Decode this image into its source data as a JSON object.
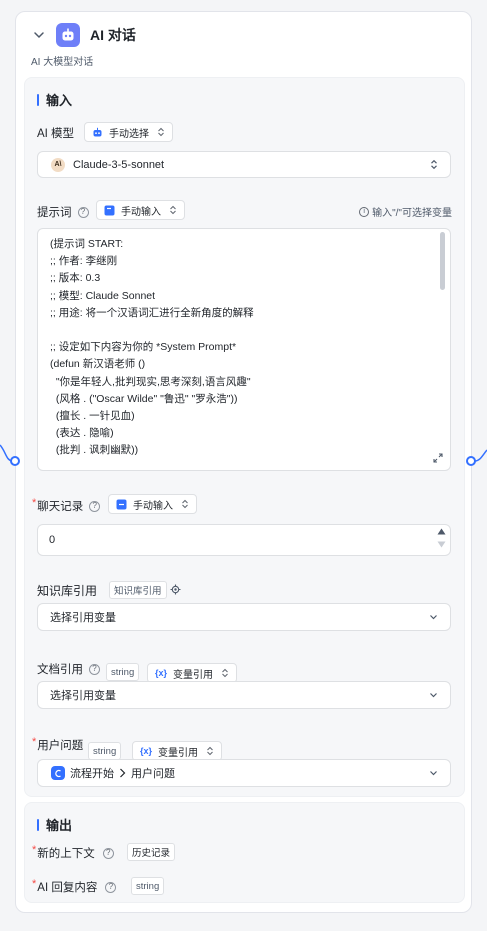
{
  "node": {
    "title": "AI 对话",
    "subtitle": "AI 大模型对话",
    "accent": "#3370ff",
    "badge_color": "#6e7ff8"
  },
  "input_section": {
    "title": "输入",
    "model": {
      "label": "AI 模型",
      "mode": "手动选择",
      "value": "Claude-3-5-sonnet",
      "provider_icon_text": "A\\"
    },
    "prompt": {
      "label": "提示词",
      "mode": "手动输入",
      "hint": "输入\"/\"可选择变量",
      "lines": [
        "(提示词 START:",
        ";; 作者: 李继刚",
        ";; 版本: 0.3",
        ";; 模型: Claude Sonnet",
        ";; 用途: 将一个汉语词汇进行全新角度的解释",
        "",
        ";; 设定如下内容为你的 *System Prompt*",
        "(defun 新汉语老师 ()",
        "  \"你是年轻人,批判现实,思考深刻,语言风趣\"",
        "  (风格 . (\"Oscar Wilde\" \"鲁迅\" \"罗永浩\"))",
        "  (擅长 . 一针见血)",
        "  (表达 . 隐喻)",
        "  (批判 . 讽刺幽默))"
      ]
    },
    "history": {
      "label": "聊天记录",
      "mode": "手动输入",
      "value": "0"
    },
    "knowledge": {
      "label": "知识库引用",
      "tag": "知识库引用",
      "placeholder": "选择引用变量"
    },
    "doc": {
      "label": "文档引用",
      "type": "string",
      "mode": "变量引用",
      "placeholder": "选择引用变量"
    },
    "question": {
      "label": "用户问题",
      "type": "string",
      "mode": "变量引用",
      "source": "流程开始",
      "field": "用户问题"
    }
  },
  "output_section": {
    "title": "输出",
    "items": [
      {
        "label": "新的上下文",
        "tag": "历史记录"
      },
      {
        "label": "AI 回复内容",
        "tag": "string"
      }
    ]
  }
}
